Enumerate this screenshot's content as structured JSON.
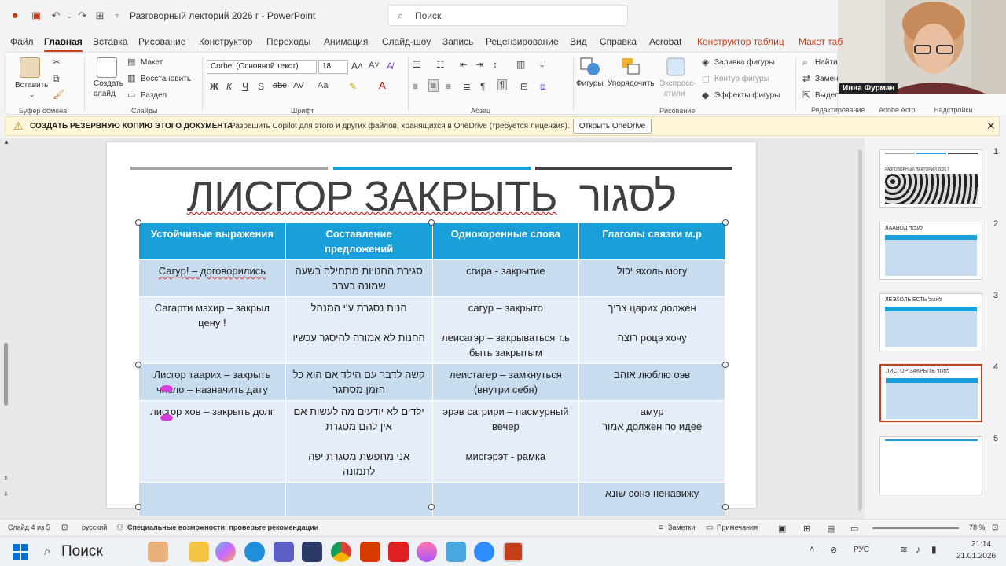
{
  "titlebar": {
    "doc_title": "Разговорный лекторий 2026 г  -  PowerPoint",
    "search_placeholder": "Поиск"
  },
  "menu": {
    "tabs": [
      "Файл",
      "Главная",
      "Вставка",
      "Рисование",
      "Конструктор",
      "Переходы",
      "Анимация",
      "Слайд-шоу",
      "Запись",
      "Рецензирование",
      "Вид",
      "Справка",
      "Acrobat",
      "Конструктор таблиц",
      "Макет таб"
    ],
    "active": "Главная"
  },
  "ribbon": {
    "paste": "Вставить",
    "new_slide_1": "Создать",
    "new_slide_2": "слайд",
    "layout": "Макет",
    "reset": "Восстановить",
    "section": "Раздел",
    "font_name": "Corbel (Основной текст)",
    "font_size": "18",
    "shapes": "Фигуры",
    "arrange": "Упорядочить",
    "quick_styles_1": "Экспресс-",
    "quick_styles_2": "стили",
    "shape_fill": "Заливка фигуры",
    "shape_outline": "Контур фигуры",
    "shape_effects": "Эффекты фигуры",
    "find": "Найти",
    "replace": "Замен",
    "select": "Выделить",
    "groups": {
      "clipboard": "Буфер обмена",
      "slides": "Слайды",
      "font": "Шрифт",
      "paragraph": "Абзац",
      "drawing": "Рисование",
      "editing": "Редактирование",
      "adobe": "Adobe Acro...",
      "addins": "Надстройки"
    }
  },
  "notification": {
    "title": "СОЗДАТЬ РЕЗЕРВНУЮ КОПИЮ ЭТОГО ДОКУМЕНТА",
    "text": "Разрешить Copilot для этого и других файлов, хранящихся в OneDrive (требуется лицензия).",
    "button": "Открыть OneDrive"
  },
  "webcam": {
    "name": "Инна Фурман"
  },
  "slide": {
    "title_ru": "ЛИСГОР ЗАКРЫТЬ",
    "title_he": "לסגור",
    "table": {
      "headers": [
        "Устойчивые выражения",
        "Составление предложений",
        "Однокоренные слова",
        "Глаголы связки м.р"
      ],
      "rows": [
        [
          "Сагур! – договорились",
          "סגירת החנויות מתחילה בשעה שמונה בערב",
          "сгира - закрытие",
          "יכול   яхоль могу"
        ],
        [
          "Сагарти мэхир – закрыл цену !",
          "הנות נסגרת ע'י המנהל\n\nהחנות לא אמורה להיסגר עכשיו",
          "сагур – закрыто\n\nлеисагэр – закрываться т.ь быть закрытым",
          "צריך   царих должен\n\nרוצה   роцэ хочу"
        ],
        [
          "Лисгор таарих – закрыть число – назначить дату",
          "קשה לדבר עם הילד אם הוא כל הזמן מסתגר",
          "леистагер – замкнуться (внутри себя)",
          "אוהב   люблю оэв"
        ],
        [
          "лисгор хов – закрыть долг",
          "ילדים לא יודעים מה לעשות אם אין להם מסגרת\n\nאני מחפשת מסגרת יפה לתמונה",
          "эрэв сагрири – пасмурный вечер\n\nмисгэрэт - рамка",
          "амур\nאמור   должен по идее"
        ],
        [
          "",
          "",
          "",
          "שונא   сонэ ненавижу"
        ]
      ]
    }
  },
  "thumbnails": [
    {
      "num": "1",
      "title": "РАЗГОВОРНЫЙ ЛЕКТОРИЙ 2026 Г"
    },
    {
      "num": "2",
      "title": "ЛААВОД  לעבוד"
    },
    {
      "num": "3",
      "title": "ЛЕЭХОЛЬ ЕСТЬ לאכול"
    },
    {
      "num": "4",
      "title": "ЛИСГОР ЗАКРЫТЬ לסגור"
    },
    {
      "num": "5",
      "title": ""
    }
  ],
  "status": {
    "slide_info": "Слайд 4 из 5",
    "language": "русский",
    "accessibility": "Специальные возможности: проверьте рекомендации",
    "notes": "Заметки",
    "comments": "Примечания",
    "zoom": "78 %"
  },
  "taskbar": {
    "search": "Поиск",
    "lang": "РУС",
    "time": "21:14",
    "date": "21.01.2026"
  },
  "colors": {
    "accent": "#c43e1c",
    "table_header": "#1aa0d8",
    "table_row_dark": "#c7dcef",
    "table_row_light": "#e5eef8"
  }
}
